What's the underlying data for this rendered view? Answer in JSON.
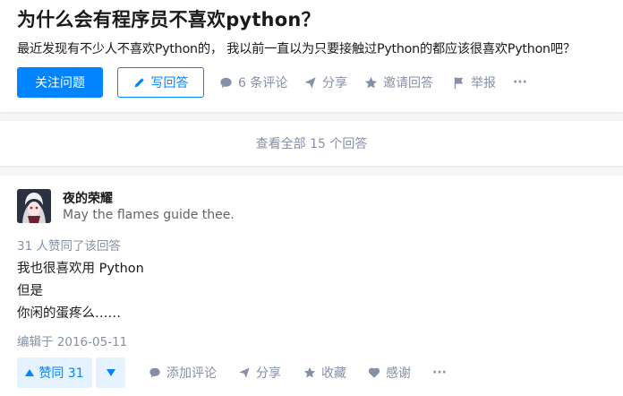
{
  "question": {
    "title": "为什么会有程序员不喜欢python？",
    "detail": "最近发现有不少人不喜欢Python的， 我以前一直以为只要接触过Python的都应该很喜欢Python吧？",
    "follow_label": "关注问题",
    "answer_label": "写回答",
    "comments_label": "6 条评论",
    "share_label": "分享",
    "invite_label": "邀请回答",
    "report_label": "举报",
    "more_label": "···"
  },
  "view_all_label": "查看全部 15 个回答",
  "answer": {
    "author_name": "夜的荣耀",
    "author_bio": "May the flames guide thee.",
    "voters_text": "31 人赞同了该回答",
    "content_lines": [
      "我也很喜欢用 Python",
      "但是",
      "你闲的蛋疼么……"
    ],
    "edited_text": "编辑于 2016-05-11",
    "upvote_label": "赞同 31",
    "comment_label": "添加评论",
    "share_label": "分享",
    "collect_label": "收藏",
    "thanks_label": "感谢",
    "more_label": "···"
  },
  "colors": {
    "brand": "#0084ff",
    "muted": "#8590a6",
    "upvote_bg": "#e5f2ff"
  },
  "icons": [
    "pencil-icon",
    "comment-icon",
    "share-icon",
    "star-icon",
    "flag-icon",
    "heart-icon",
    "caret-up-icon",
    "caret-down-icon"
  ]
}
